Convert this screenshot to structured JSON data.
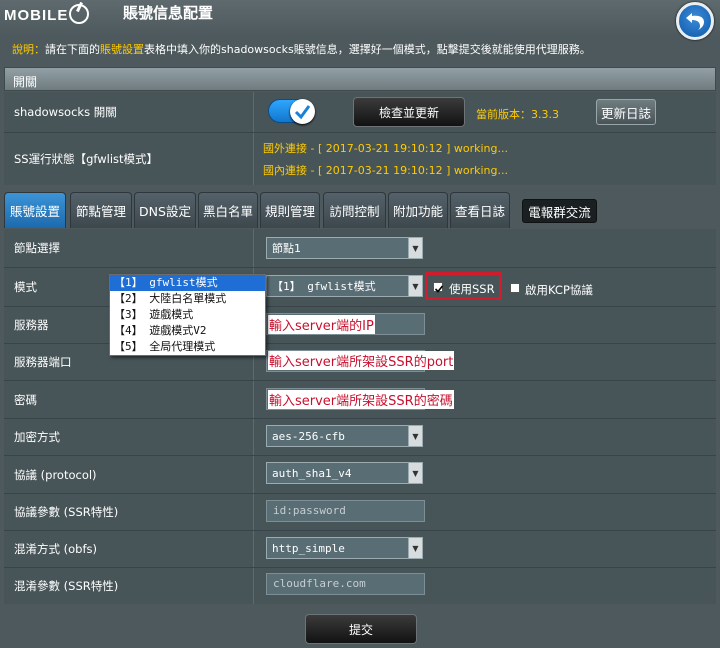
{
  "header": {
    "logo": "MOBILE",
    "title": "賬號信息配置"
  },
  "description": {
    "prefix": "說明：",
    "part1": "請在下面的",
    "highlight": "賬號設置",
    "part2": "表格中填入你的shadowsocks賬號信息，選擇好一個模式，點擊提交後就能使用代理服務。"
  },
  "switch_section": {
    "title": "開關",
    "shadowsocks_label": "shadowsocks 開關",
    "check_update_label": "檢查並更新",
    "version_text": "當前版本：3.3.3",
    "changelog_label": "更新日誌",
    "status_label": "SS運行狀態【gfwlist模式】",
    "status_foreign": "國外連接 - [ 2017-03-21 19:10:12 ] working...",
    "status_domestic": "國內連接 - [ 2017-03-21 19:10:12 ] working..."
  },
  "tabs": [
    {
      "label": "賬號設置",
      "active": true
    },
    {
      "label": "節點管理",
      "active": false
    },
    {
      "label": "DNS設定",
      "active": false
    },
    {
      "label": "黑白名單",
      "active": false
    },
    {
      "label": "規則管理",
      "active": false
    },
    {
      "label": "訪問控制",
      "active": false
    },
    {
      "label": "附加功能",
      "active": false
    },
    {
      "label": "查看日誌",
      "active": false
    },
    {
      "label": "電報群交流",
      "active": false
    }
  ],
  "form": {
    "node_label": "節點選擇",
    "node_value": "節點1",
    "mode_label": "模式",
    "mode_value": "【1】 gfwlist模式",
    "mode_options": [
      "【1】 gfwlist模式",
      "【2】 大陸白名單模式",
      "【3】 遊戲模式",
      "【4】 遊戲模式V2",
      "【5】 全局代理模式"
    ],
    "use_ssr_label": "使用SSR",
    "use_ssr_checked": true,
    "kcp_label": "啟用KCP協議",
    "kcp_checked": false,
    "server_label": "服務器",
    "server_annotation": "輸入server端的IP",
    "port_label": "服務器端口",
    "port_annotation": "輸入server端所架設SSR的port",
    "password_label": "密碼",
    "password_annotation": "輸入server端所架設SSR的密碼",
    "encryption_label": "加密方式",
    "encryption_value": "aes-256-cfb",
    "protocol_label": "協議 (protocol)",
    "protocol_value": "auth_sha1_v4",
    "protocol_param_label": "協議參數 (SSR特性)",
    "protocol_param_placeholder": "id:password",
    "obfs_label": "混淆方式 (obfs)",
    "obfs_value": "http_simple",
    "obfs_param_label": "混淆參數 (SSR特性)",
    "obfs_param_placeholder": "cloudflare.com"
  },
  "submit_label": "提交",
  "colors": {
    "background": "#4d595d",
    "accent_blue": "#1c6aad",
    "status_yellow": "#ffcc00",
    "annotation_red": "#c8102e"
  }
}
